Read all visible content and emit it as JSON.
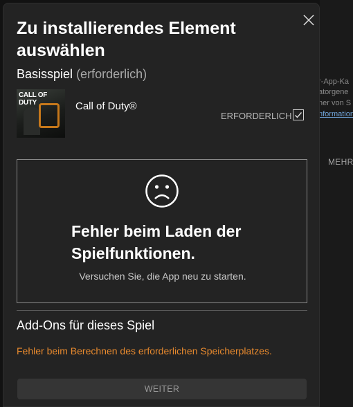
{
  "background": {
    "fragments": [
      "r-App-Ka",
      "atorgene",
      "ner von S",
      "nformation"
    ],
    "more_label": "MEHR"
  },
  "dialog": {
    "title": "Zu installierendes Element auswählen",
    "close_icon": "close-icon",
    "base_section": {
      "label": "Basisspiel",
      "qualifier": "(erforderlich)"
    },
    "game": {
      "art_logo_text": "CALL OF DUTY",
      "name": "Call of Duty®",
      "required_label": "ERFORDERLICH",
      "checked": true
    },
    "error_panel": {
      "icon": "sad-face-icon",
      "title": "Fehler beim Laden der Spielfunktionen.",
      "subtitle": "Versuchen Sie, die App neu zu starten."
    },
    "addons": {
      "label": "Add-Ons für dieses Spiel",
      "error": "Fehler beim Berechnen des erforderlichen Speicherplatzes."
    },
    "continue_button": "WEITER"
  },
  "colors": {
    "dialog_bg": "#232323",
    "warning": "#e88a2e",
    "link": "#6fa3d8"
  }
}
